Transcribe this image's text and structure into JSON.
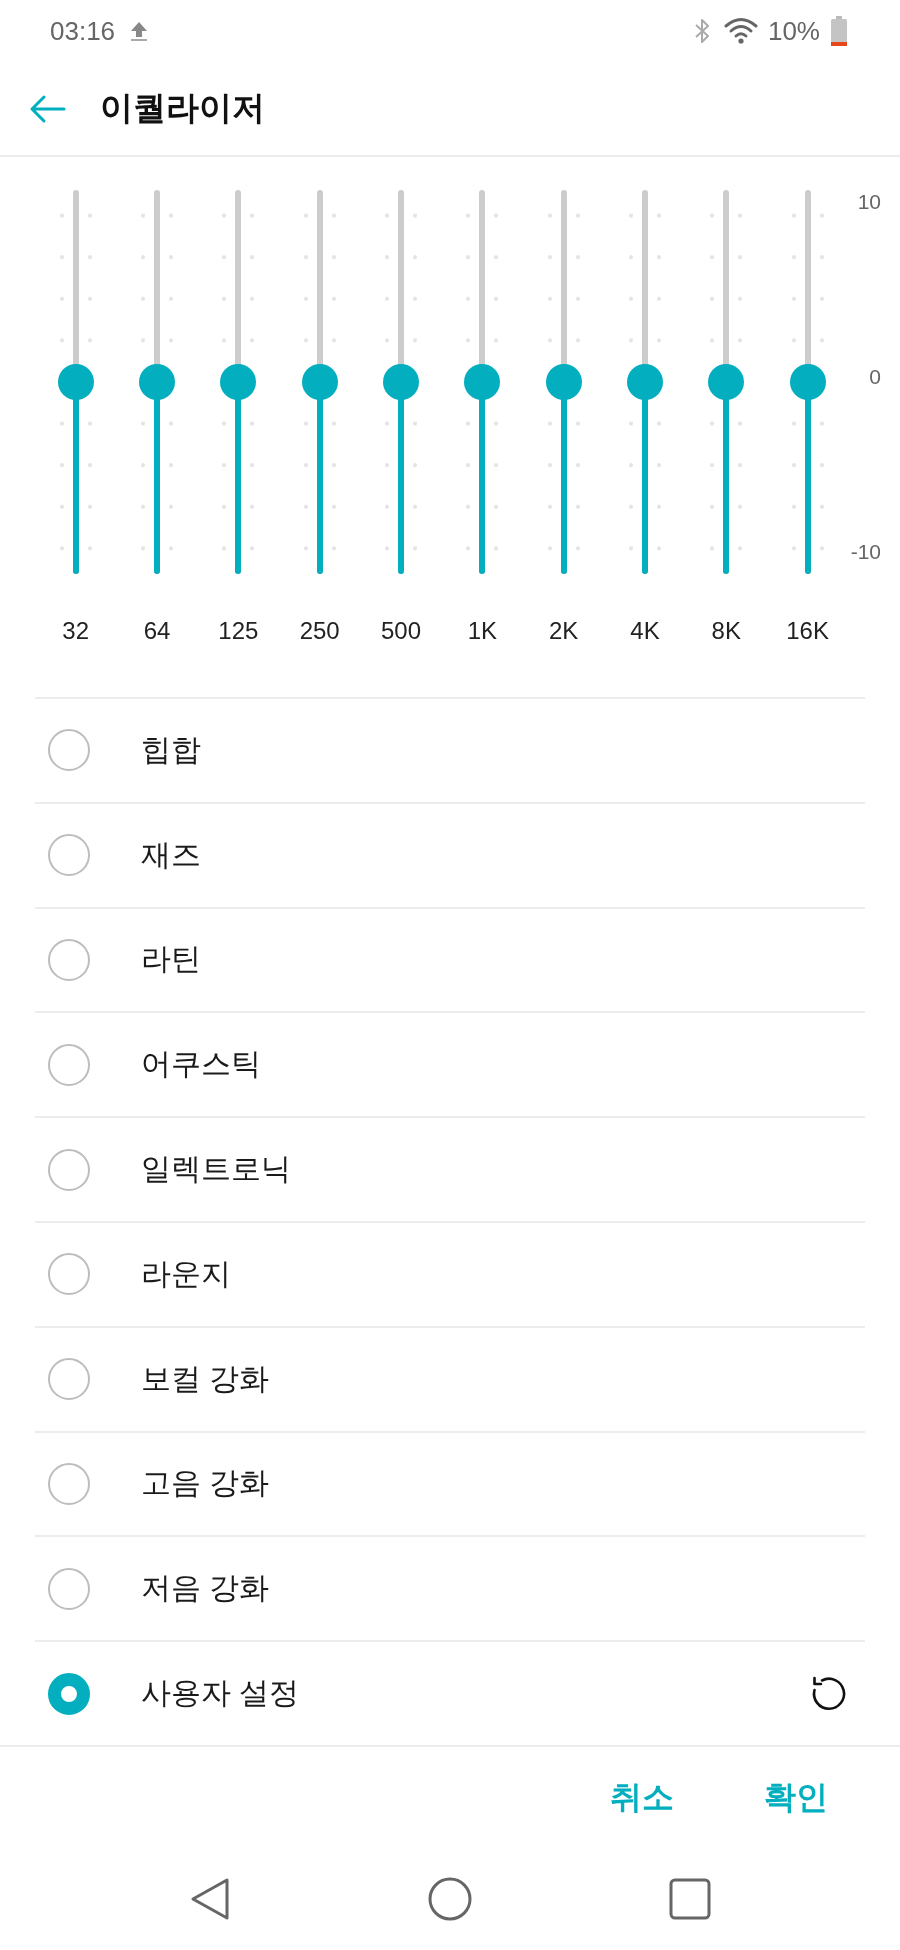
{
  "status_bar": {
    "time": "03:16",
    "battery_percent": "10%"
  },
  "header": {
    "title": "이퀄라이저"
  },
  "equalizer": {
    "scale": [
      "10",
      "0",
      "-10"
    ],
    "bands": [
      {
        "label": "32",
        "level": 0.5
      },
      {
        "label": "64",
        "level": 0.5
      },
      {
        "label": "125",
        "level": 0.5
      },
      {
        "label": "250",
        "level": 0.5
      },
      {
        "label": "500",
        "level": 0.5
      },
      {
        "label": "1K",
        "level": 0.5
      },
      {
        "label": "2K",
        "level": 0.5
      },
      {
        "label": "4K",
        "level": 0.5
      },
      {
        "label": "8K",
        "level": 0.5
      },
      {
        "label": "16K",
        "level": 0.5
      }
    ]
  },
  "presets": [
    {
      "label": "힙합",
      "kind": "preset",
      "selected": false
    },
    {
      "label": "재즈",
      "kind": "preset",
      "selected": false
    },
    {
      "label": "라틴",
      "kind": "preset",
      "selected": false
    },
    {
      "label": "어쿠스틱",
      "kind": "preset",
      "selected": false
    },
    {
      "label": "일렉트로닉",
      "kind": "preset",
      "selected": false
    },
    {
      "label": "라운지",
      "kind": "preset",
      "selected": false
    },
    {
      "label": "보컬 강화",
      "kind": "preset",
      "selected": false
    },
    {
      "label": "고음 강화",
      "kind": "preset",
      "selected": false
    },
    {
      "label": "저음 강화",
      "kind": "preset",
      "selected": false
    },
    {
      "label": "사용자 설정",
      "kind": "custom",
      "selected": true
    }
  ],
  "buttons": [
    "취소",
    "확인"
  ]
}
